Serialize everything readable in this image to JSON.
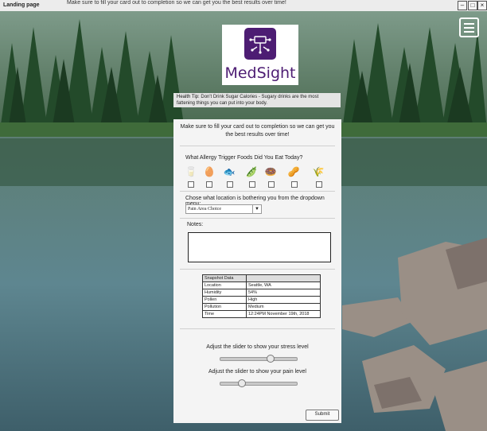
{
  "window": {
    "title": "Landing page",
    "subtitle": "Make sure to fill your card out to completion so we can get you the best results over time!"
  },
  "brand": {
    "name": "MedSight"
  },
  "health_tip": {
    "label": "Health Tip:",
    "text": "Don't Drink Sugar Calories - Sugary drinks are the most fattening things you can put into your body."
  },
  "form": {
    "intro": "Make sure to fill your card out to completion so we can get you the best results over time!",
    "allergy_question": "What Allergy Trigger Foods Did You Eat Today?",
    "foods": [
      {
        "name": "milk",
        "icon": "milk-carton-icon",
        "glyph": "🥛",
        "checked": false
      },
      {
        "name": "egg",
        "icon": "egg-icon",
        "glyph": "🥚",
        "checked": false
      },
      {
        "name": "fish",
        "icon": "fish-icon",
        "glyph": "🐟",
        "checked": false
      },
      {
        "name": "peas",
        "icon": "peas-icon",
        "glyph": "🫛",
        "checked": false
      },
      {
        "name": "donut",
        "icon": "donut-icon",
        "glyph": "🍩",
        "checked": false
      },
      {
        "name": "peanuts",
        "icon": "peanut-icon",
        "glyph": "🥜",
        "checked": false
      },
      {
        "name": "wheat",
        "icon": "wheat-icon",
        "glyph": "🌾",
        "checked": false
      }
    ],
    "location_question": "Chose what location is bothering you from the dropdown menu:",
    "location_select": {
      "value": "Pain Area Choice"
    },
    "notes_label": "Notes:",
    "notes_value": "",
    "snapshot": {
      "header": "Snapshot Data",
      "rows": [
        {
          "key": "Location",
          "value": "Seattle, WA"
        },
        {
          "key": "Humidity",
          "value": "54%"
        },
        {
          "key": "Pollen",
          "value": "High"
        },
        {
          "key": "Pollution",
          "value": "Medium"
        },
        {
          "key": "Time",
          "value": "12:24PM November 19th, 2018"
        }
      ]
    },
    "stress_slider": {
      "label": "Adjust the slider to show your stress level",
      "value": 0.68
    },
    "pain_slider": {
      "label": "Adjust the slider to show your pain level",
      "value": 0.26
    },
    "submit_label": "Submit"
  },
  "colors": {
    "brand_purple": "#4d1d73",
    "panel_bg": "#f4f4f4"
  }
}
